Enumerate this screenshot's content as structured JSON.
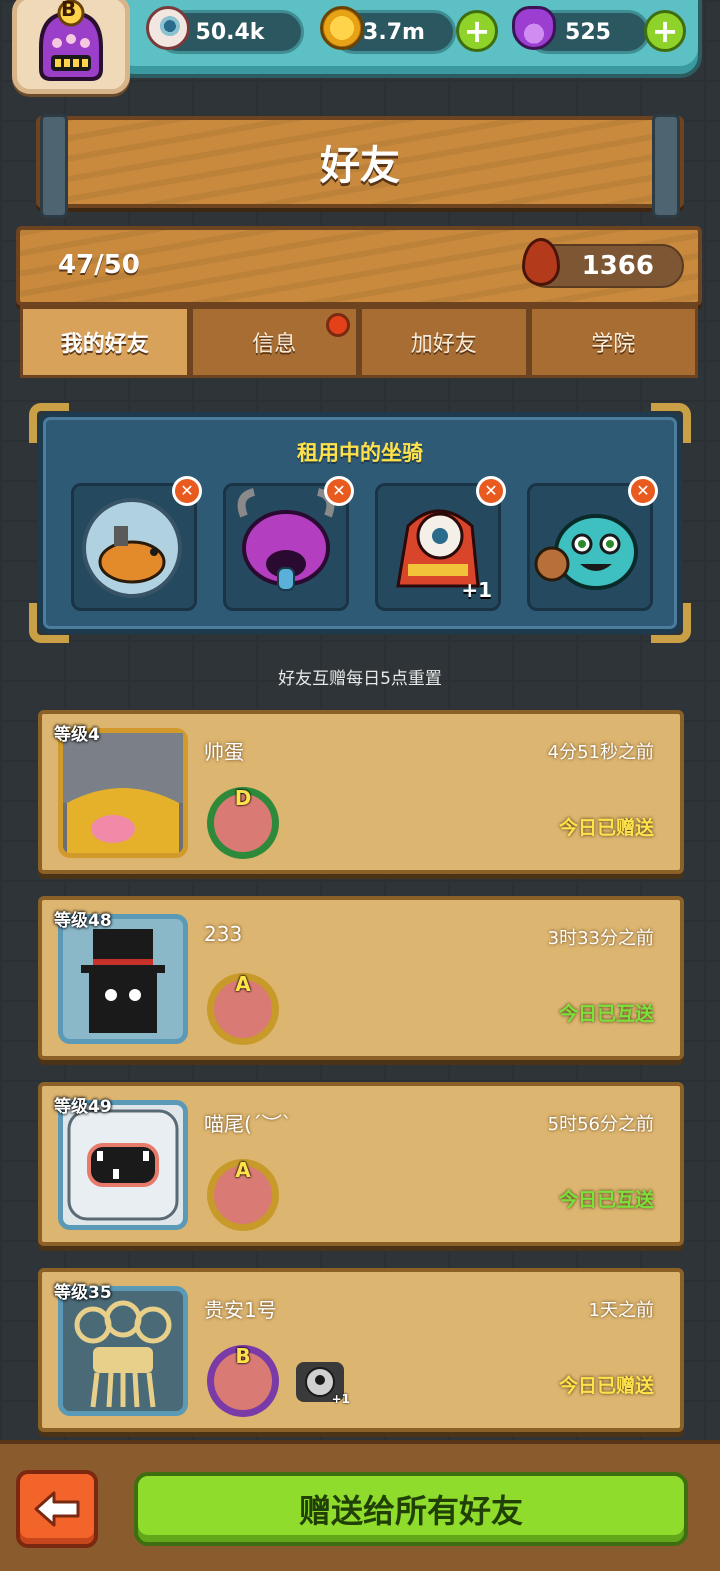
{
  "header": {
    "player_rank": "B",
    "resources": [
      {
        "icon": "eyeball-icon",
        "value": "50.4k"
      },
      {
        "icon": "coin-icon",
        "value": "3.7m"
      },
      {
        "icon": "potion-icon",
        "value": "525"
      }
    ]
  },
  "title": "好友",
  "info": {
    "friend_count": "47/50",
    "blood_value": "1366"
  },
  "tabs": [
    {
      "label": "我的好友",
      "active": true
    },
    {
      "label": "信息",
      "has_notification": true
    },
    {
      "label": "加好友"
    },
    {
      "label": "学院"
    }
  ],
  "mounts": {
    "title": "租用中的坐骑",
    "items": [
      {
        "icon": "hamster-ball-mount-icon"
      },
      {
        "icon": "purple-horned-monster-mount-icon"
      },
      {
        "icon": "lion-dance-mount-icon",
        "extra": "+1"
      },
      {
        "icon": "teal-shield-monster-mount-icon"
      }
    ]
  },
  "hint": "好友互赠每日5点重置",
  "friends": [
    {
      "level": "等级4",
      "name": "帅蛋",
      "time": "4分51秒之前",
      "status": "今日已赠送",
      "status_color": "#ffe24a",
      "rank": "D",
      "rank_color": "#d97a74",
      "badge_ring": "#2e8a3a",
      "frame_color": "#d19a2a",
      "portrait_color": "#6b6f78"
    },
    {
      "level": "等级48",
      "name": "233",
      "time": "3时33分之前",
      "status": "今日已互送",
      "status_color": "#7be23a",
      "rank": "A",
      "rank_color": "#d97a74",
      "badge_ring": "#c79a2a",
      "frame_color": "#5a9ab6",
      "portrait_color": "#1a1a1a"
    },
    {
      "level": "等级49",
      "name": "喵尾(´︶`",
      "time": "5时56分之前",
      "status": "今日已互送",
      "status_color": "#7be23a",
      "rank": "A",
      "rank_color": "#d97a74",
      "badge_ring": "#c79a2a",
      "frame_color": "#5a9ab6",
      "portrait_color": "#dfe6ea"
    },
    {
      "level": "等级35",
      "name": "贵安1号",
      "time": "1天之前",
      "status": "今日已赠送",
      "status_color": "#ffe24a",
      "rank": "B",
      "rank_color": "#d97a74",
      "badge_ring": "#7a3aa8",
      "frame_color": "#5a9ab6",
      "portrait_color": "#c9a86a",
      "mount_extra": "+1"
    }
  ],
  "footer": {
    "gift_all_label": "赠送给所有好友"
  }
}
